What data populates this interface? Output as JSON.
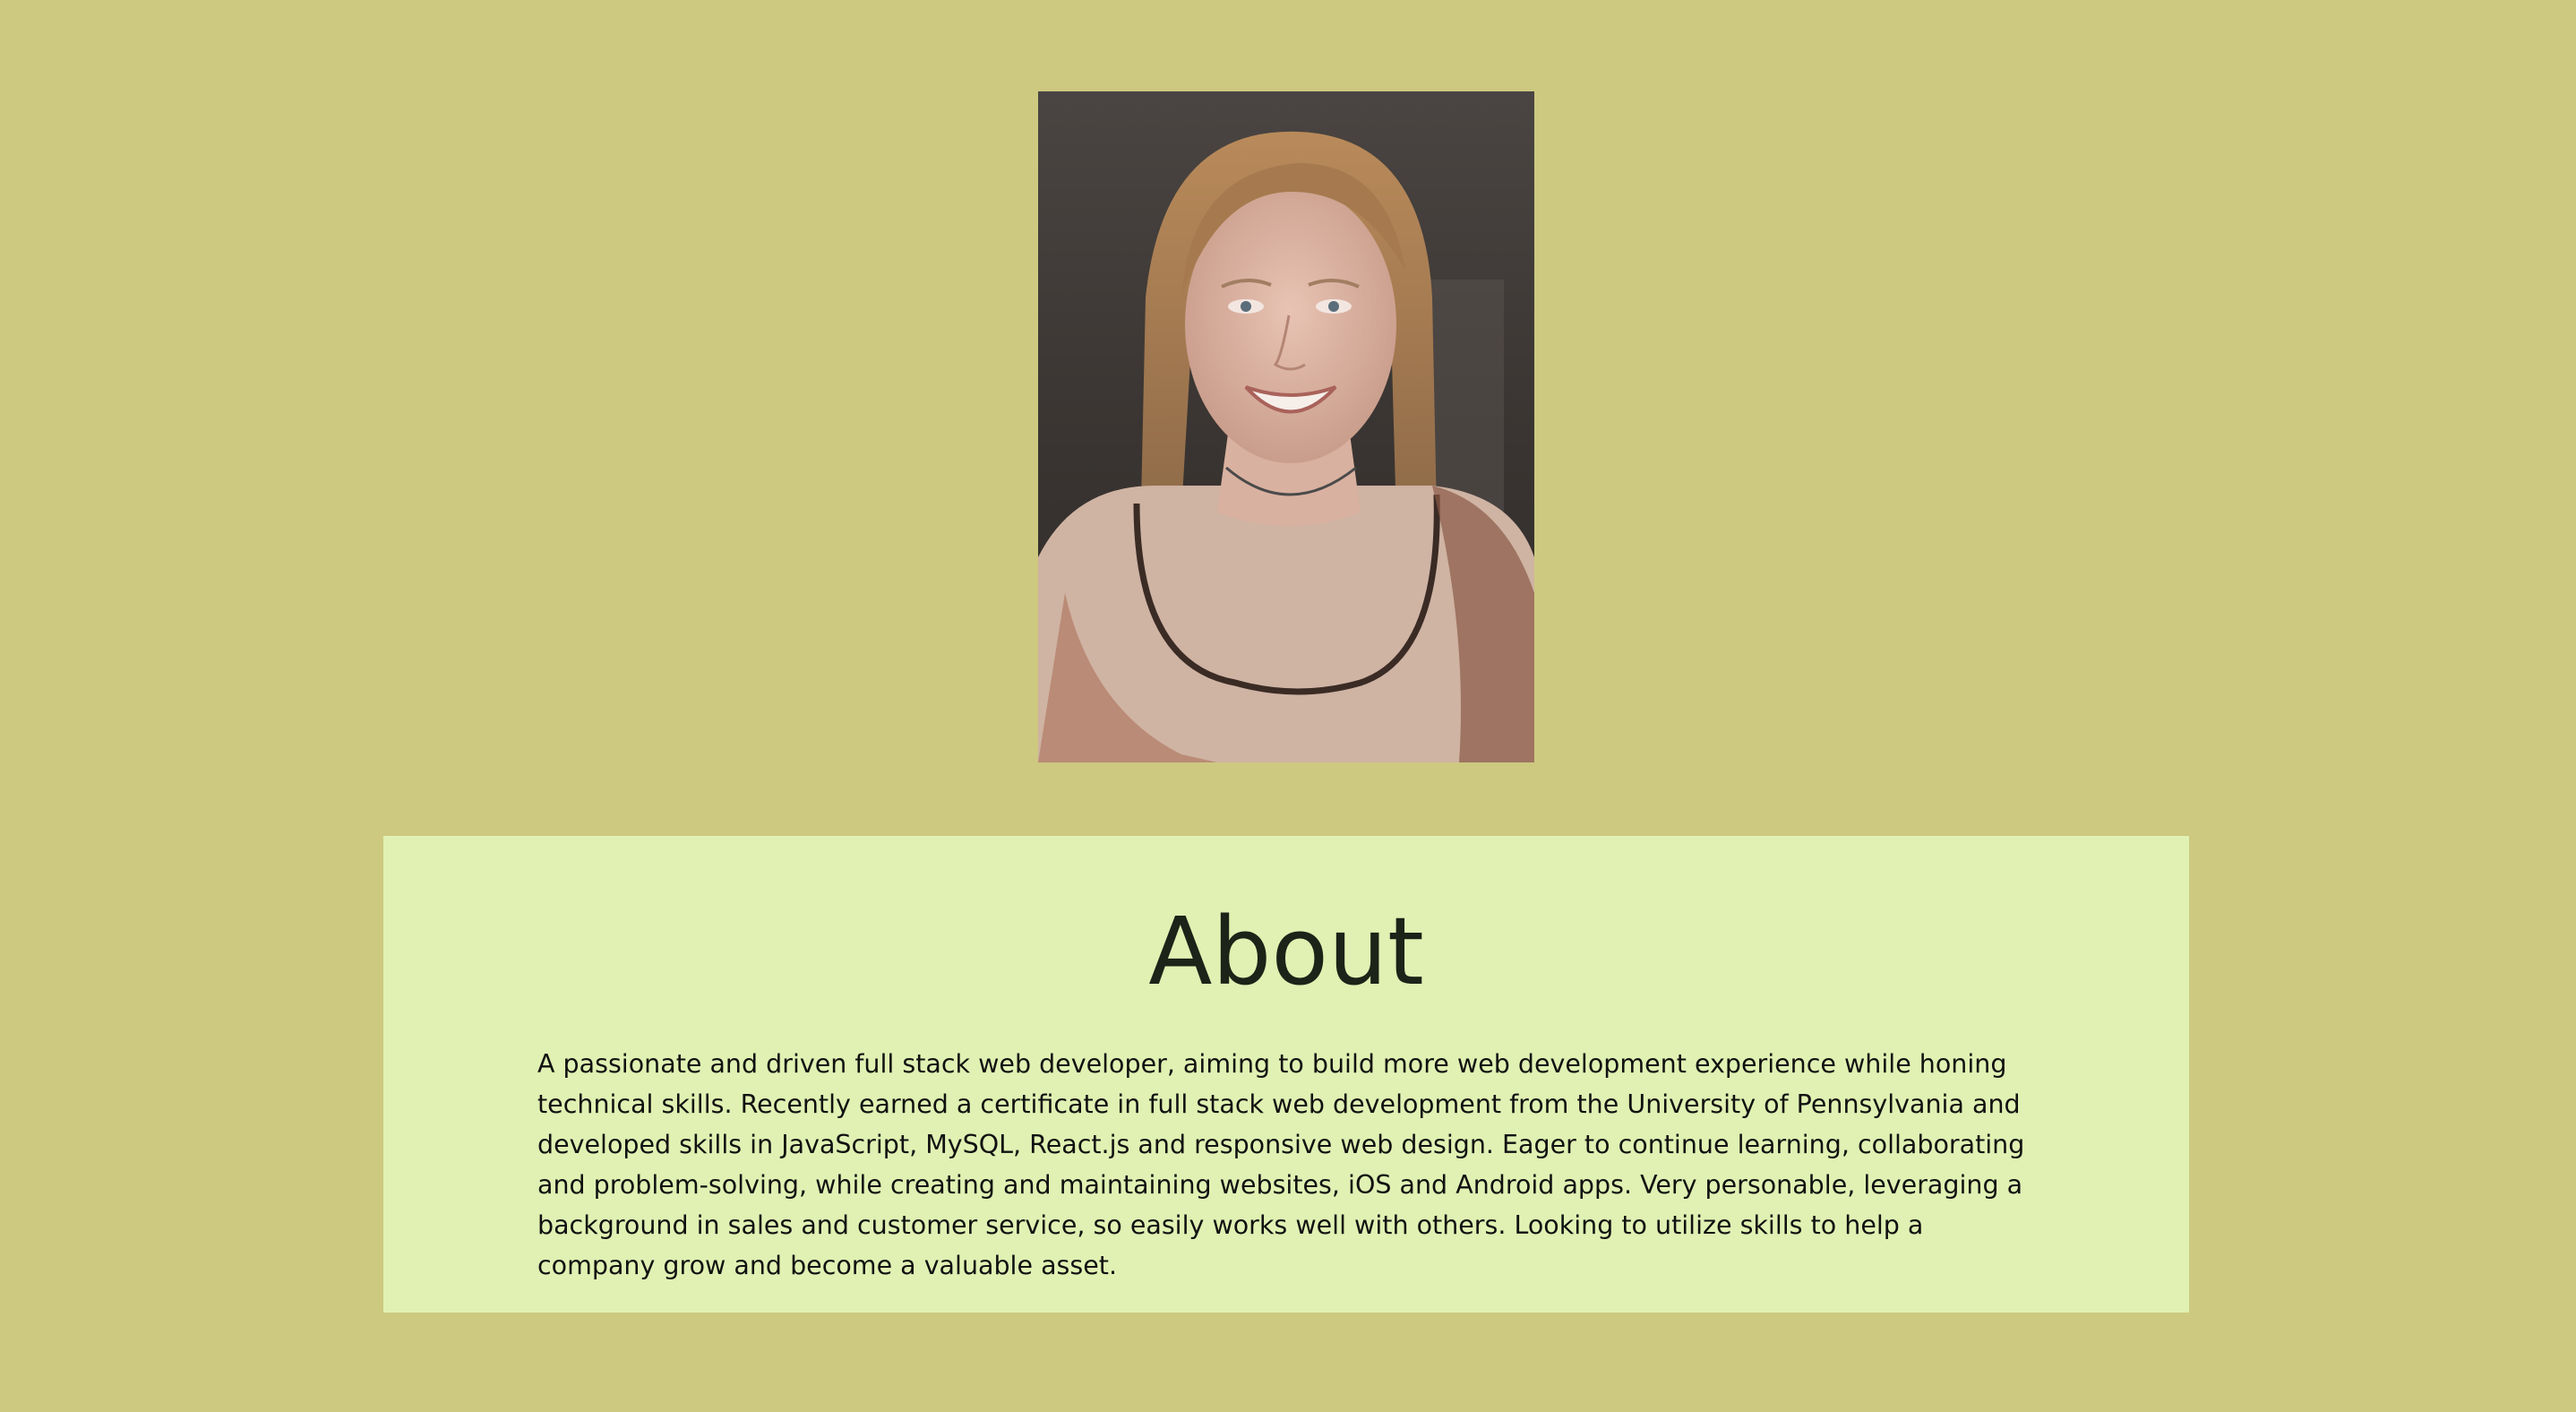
{
  "colors": {
    "page_background": "#cdc980",
    "about_background": "#e0f1b3",
    "title_color": "#1c2318"
  },
  "profile": {
    "photo_icon": "portrait-photo"
  },
  "about": {
    "title": "About",
    "text": "A passionate and driven full stack web developer, aiming to build more web development experience while honing technical skills. Recently earned a certificate in full stack web development from the University of Pennsylvania and developed skills in JavaScript, MySQL, React.js and responsive web design. Eager to continue learning, collaborating and problem-solving, while creating and maintaining websites, iOS and Android apps. Very personable, leveraging a background in sales and customer service, so easily works well with others. Looking to utilize skills to help a company grow and become a valuable asset."
  }
}
